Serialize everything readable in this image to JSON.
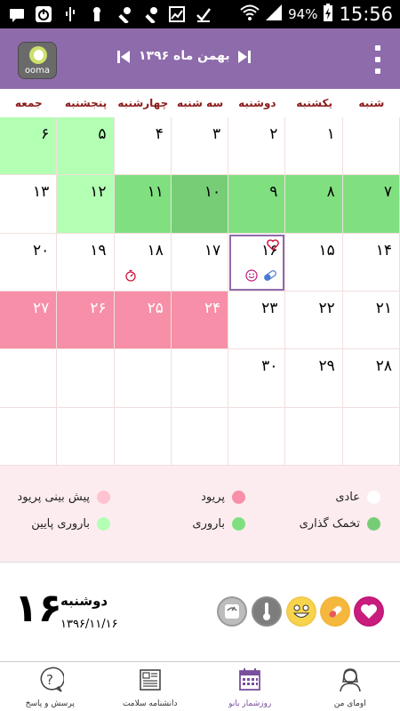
{
  "status_bar": {
    "battery": "94%",
    "time": "15:56"
  },
  "app": {
    "logo_text": "ooma"
  },
  "month_nav": {
    "title": "بهمن ماه ۱۳۹۶"
  },
  "weekdays": [
    "شنبه",
    "یکشنبه",
    "دوشنبه",
    "سه شنبه",
    "چهارشنبه",
    "پنجشنبه",
    "جمعه"
  ],
  "calendar": {
    "rows": [
      [
        {
          "n": "",
          "c": "white"
        },
        {
          "n": "۱",
          "c": "white"
        },
        {
          "n": "۲",
          "c": "white"
        },
        {
          "n": "۳",
          "c": "white"
        },
        {
          "n": "۴",
          "c": "white"
        },
        {
          "n": "۵",
          "c": "lightgreen"
        },
        {
          "n": "۶",
          "c": "lightgreen"
        }
      ],
      [
        {
          "n": "۷",
          "c": "green"
        },
        {
          "n": "۸",
          "c": "green"
        },
        {
          "n": "۹",
          "c": "green"
        },
        {
          "n": "۱۰",
          "c": "darkgreen"
        },
        {
          "n": "۱۱",
          "c": "green"
        },
        {
          "n": "۱۲",
          "c": "lightgreen"
        },
        {
          "n": "۱۳",
          "c": "white"
        }
      ],
      [
        {
          "n": "۱۴",
          "c": "white"
        },
        {
          "n": "۱۵",
          "c": "white"
        },
        {
          "n": "۱۶",
          "c": "white"
        },
        {
          "n": "۱۷",
          "c": "white"
        },
        {
          "n": "۱۸",
          "c": "white"
        },
        {
          "n": "۱۹",
          "c": "white"
        },
        {
          "n": "۲۰",
          "c": "white"
        }
      ],
      [
        {
          "n": "۲۱",
          "c": "white"
        },
        {
          "n": "۲۲",
          "c": "white"
        },
        {
          "n": "۲۳",
          "c": "white"
        },
        {
          "n": "۲۴",
          "c": "pink"
        },
        {
          "n": "۲۵",
          "c": "pink"
        },
        {
          "n": "۲۶",
          "c": "pink"
        },
        {
          "n": "۲۷",
          "c": "pink"
        }
      ],
      [
        {
          "n": "۲۸",
          "c": "white"
        },
        {
          "n": "۲۹",
          "c": "white"
        },
        {
          "n": "۳۰",
          "c": "white"
        },
        {
          "n": "",
          "c": "white"
        },
        {
          "n": "",
          "c": "white"
        },
        {
          "n": "",
          "c": "white"
        },
        {
          "n": "",
          "c": "white"
        }
      ],
      [
        {
          "n": "",
          "c": "white"
        },
        {
          "n": "",
          "c": "white"
        },
        {
          "n": "",
          "c": "white"
        },
        {
          "n": "",
          "c": "white"
        },
        {
          "n": "",
          "c": "white"
        },
        {
          "n": "",
          "c": "white"
        },
        {
          "n": "",
          "c": "white"
        }
      ]
    ],
    "selected_day": "۱۶"
  },
  "legend": {
    "normal": "عادی",
    "period": "پریود",
    "period_forecast": "پیش بینی پریود",
    "ovulation": "تخمک گذاری",
    "fertility": "باروری",
    "low_fertility": "باروری پایین"
  },
  "summary": {
    "day_number": "۱۶",
    "day_name": "دوشنبه",
    "date": "۱۳۹۶/۱۱/۱۶"
  },
  "bottom_nav": {
    "qa": "پرسش و پاسخ",
    "encyclopedia": "دانشنامه سلامت",
    "calendar": "روزشمار بانو",
    "profile": "اومای من"
  },
  "colors": {
    "accent": "#8e6bab",
    "weekday_text": "#8b1a1a",
    "light_green": "#b3ffb3",
    "green": "#80e080",
    "dark_green": "#76cd76",
    "pink": "#f68fa7",
    "legend_bg": "#fdecef"
  }
}
